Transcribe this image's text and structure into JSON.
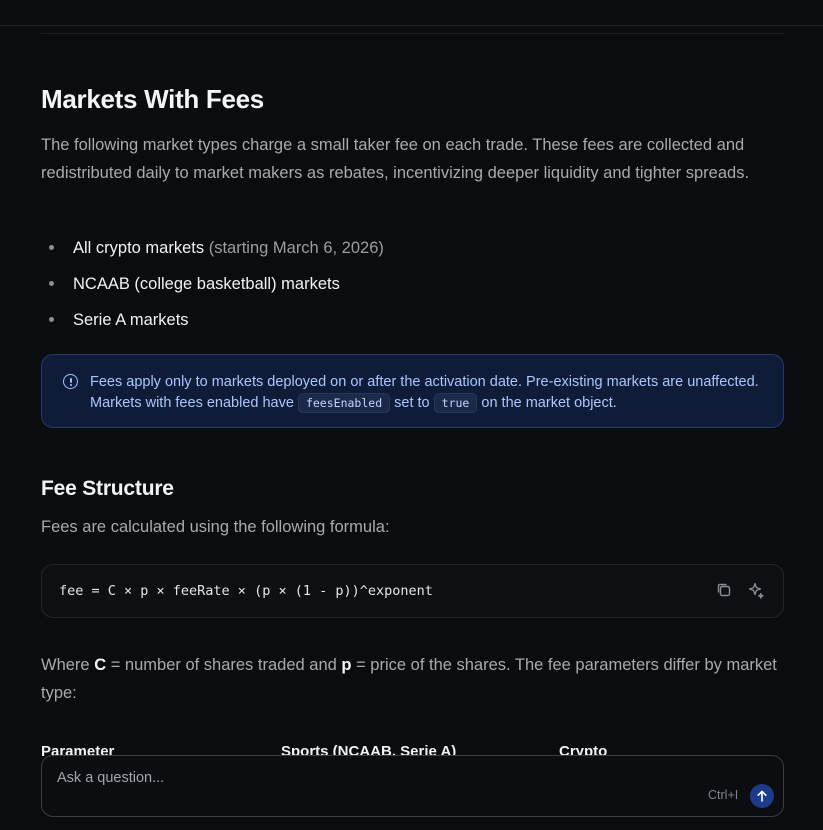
{
  "markets_with_fees": {
    "title": "Markets With Fees",
    "intro": "The following market types charge a small taker fee on each trade. These fees are collected and redistributed daily to market makers as rebates, incentivizing deeper liquidity and tighter spreads.",
    "items": [
      {
        "label": "All crypto markets",
        "note": " (starting March 6, 2026)"
      },
      {
        "label": "NCAAB (college basketball) markets"
      },
      {
        "label": "Serie A markets"
      }
    ]
  },
  "callout": {
    "icon": "info-icon",
    "text_1": "Fees apply only to markets deployed on or after the activation date. Pre-existing markets are unaffected. Markets with fees enabled have ",
    "code_1": "feesEnabled",
    "text_2": " set to ",
    "code_2": "true",
    "text_3": " on the market object."
  },
  "fee_structure": {
    "title": "Fee Structure",
    "intro": "Fees are calculated using the following formula:",
    "formula": "fee = C × p × feeRate × (p × (1 - p))^exponent",
    "where_prefix": "Where ",
    "where_c": "C",
    "where_mid": " = number of shares traded and ",
    "where_p": "p",
    "where_suffix": " = price of the shares. The fee parameters differ by market type:"
  },
  "table": {
    "headers": [
      "Parameter",
      "Sports (NCAAB, Serie A)",
      "Crypto"
    ]
  },
  "ask_bar": {
    "placeholder": "Ask a question...",
    "shortcut": "Ctrl+I"
  },
  "colors": {
    "background": "#0b0c0e",
    "callout_bg": "#0f1c38",
    "callout_text": "#a9c6ff",
    "send_button": "#1e3a8a"
  }
}
